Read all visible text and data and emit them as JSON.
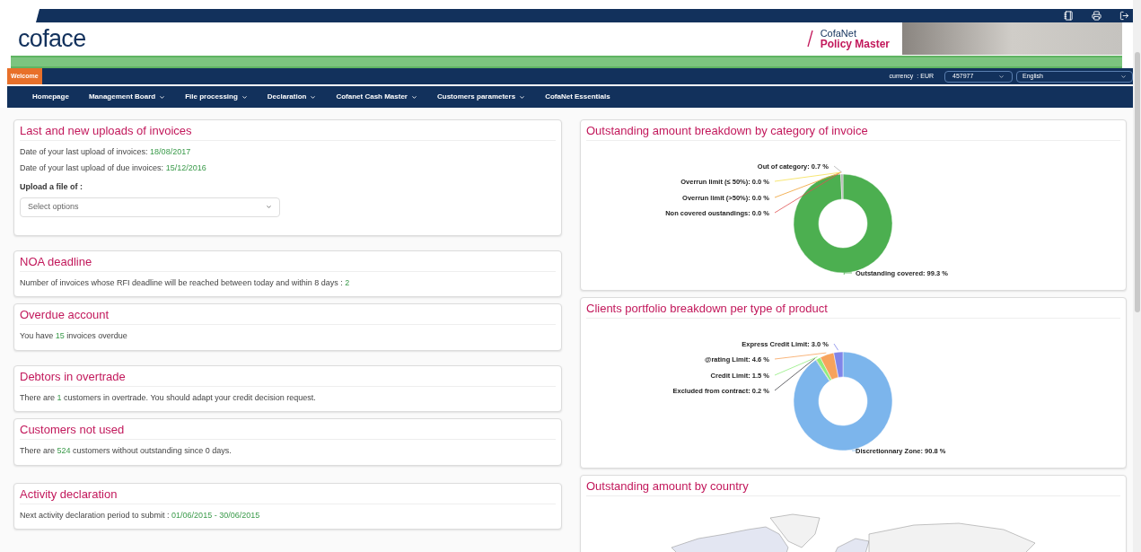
{
  "header": {
    "product_prefix": "CofaNet",
    "product_name": "Policy Master",
    "logo": "coface"
  },
  "toolbar": {
    "tab": "Welcome",
    "currency_label": "currency",
    "currency": ": EUR",
    "policy": "457977",
    "language": "English"
  },
  "nav": [
    {
      "label": "Homepage",
      "has_menu": false
    },
    {
      "label": "Management Board",
      "has_menu": true
    },
    {
      "label": "File processing",
      "has_menu": true
    },
    {
      "label": "Declaration",
      "has_menu": true
    },
    {
      "label": "Cofanet Cash Master",
      "has_menu": true
    },
    {
      "label": "Customers parameters",
      "has_menu": true
    },
    {
      "label": "CofaNet Essentials",
      "has_menu": false
    }
  ],
  "left_cards": [
    {
      "title": "Last and new uploads of invoices",
      "kind": "uploads",
      "lines": [
        {
          "text": "Date of your last upload of invoices:",
          "value": "18/08/2017"
        },
        {
          "text": "Date of your last upload of due invoices:",
          "value": "15/12/2016"
        }
      ],
      "upload_label": "Upload a file of :",
      "select_placeholder": "Select options"
    },
    {
      "title": "NOA deadline",
      "kind": "info",
      "before": "Number of invoices whose RFI deadline will be reached between today and within 8 days :",
      "value": "2"
    },
    {
      "title": "Overdue account",
      "kind": "info",
      "before": "You have",
      "value": "15",
      "after": "invoices overdue"
    },
    {
      "title": "Debtors in overtrade",
      "kind": "info",
      "before": "There are",
      "value": "1",
      "after": "customers in overtrade. You should adapt your credit decision request."
    },
    {
      "title": "Customers not used",
      "kind": "info",
      "before": "There are",
      "value": "524",
      "after": "customers without outstanding since 0 days."
    },
    {
      "title": "Activity declaration",
      "kind": "info",
      "before": "Next activity declaration period to submit :",
      "value": "01/06/2015 - 30/06/2015"
    }
  ],
  "right_cards": [
    {
      "title": "Outstanding amount breakdown by category of invoice",
      "kind": "donut",
      "chart_data": {
        "type": "donut",
        "categories": [
          "Outstanding covered",
          "Non covered oustandings",
          "Overrun limit (>50%)",
          "Overrun limit (≤ 50%)",
          "Out of category"
        ],
        "values": [
          99.3,
          0.0,
          0.0,
          0.0,
          0.7
        ],
        "colors": [
          "#4caf50",
          "#e05050",
          "#f0a030",
          "#f5e050",
          "#b0b0b0"
        ],
        "data_labels": true,
        "value_labels": [
          ": 99.3 %",
          ": 0.0 %",
          ": 0.0 %",
          ": 0.0 %",
          ": 0.7 %"
        ]
      }
    },
    {
      "title": "Clients portfolio breakdown per type of product",
      "kind": "donut",
      "chart_data": {
        "type": "donut",
        "categories": [
          "Discretionnary Zone",
          "Excluded from contract",
          "Credit Limit",
          "@rating Limit",
          "Express Credit Limit"
        ],
        "values": [
          90.8,
          0.2,
          1.5,
          4.6,
          3.0
        ],
        "colors": [
          "#7cb5ec",
          "#434348",
          "#90ed7d",
          "#f7a35c",
          "#8085e9"
        ],
        "data_labels": true,
        "value_labels": [
          ": 90.8 %",
          ": 0.2 %",
          ": 1.5 %",
          ": 4.6 %",
          ": 3.0 %"
        ]
      }
    },
    {
      "title": "Outstanding amount by country",
      "kind": "map"
    }
  ]
}
